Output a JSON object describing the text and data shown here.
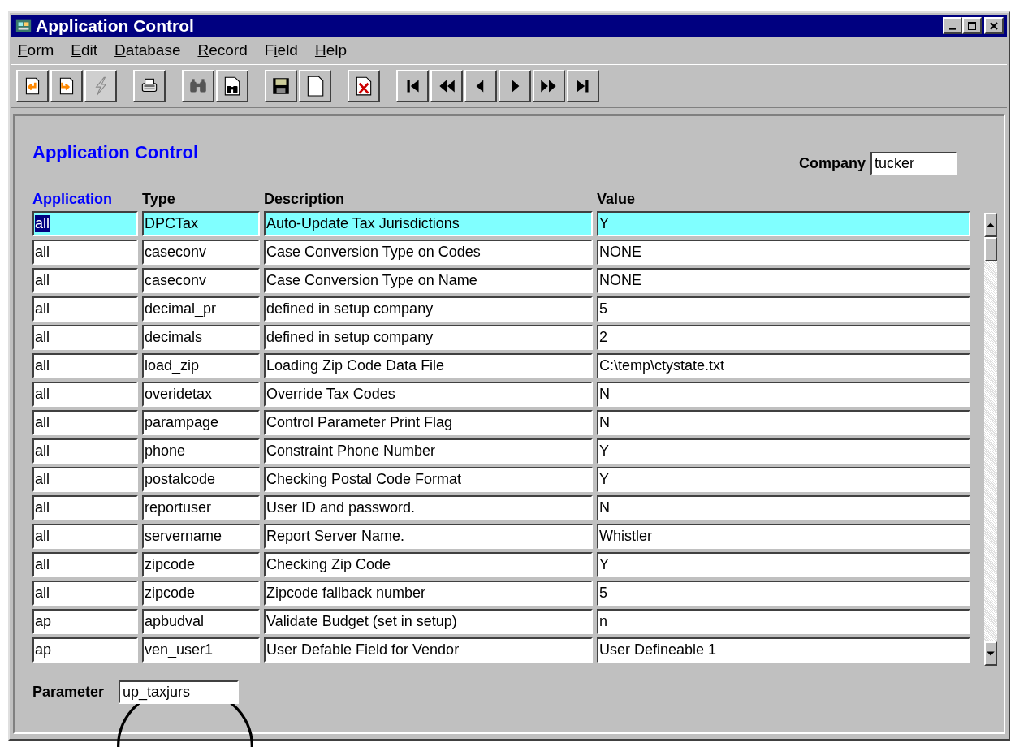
{
  "window": {
    "title": "Application Control"
  },
  "menu": [
    {
      "mnemonic": "F",
      "rest": "orm"
    },
    {
      "mnemonic": "E",
      "rest": "dit"
    },
    {
      "mnemonic": "D",
      "rest": "atabase"
    },
    {
      "mnemonic": "R",
      "rest": "ecord"
    },
    {
      "lead": "F",
      "mnemonic": "i",
      "rest": "eld"
    },
    {
      "mnemonic": "H",
      "rest": "elp"
    }
  ],
  "toolbar": [
    [
      {
        "kind": "enter",
        "disabled": false
      },
      {
        "kind": "exit",
        "disabled": false
      },
      {
        "kind": "execute",
        "disabled": true
      }
    ],
    [
      {
        "kind": "print",
        "disabled": false
      }
    ],
    [
      {
        "kind": "find",
        "disabled": false
      },
      {
        "kind": "findpage",
        "disabled": false
      }
    ],
    [
      {
        "kind": "save",
        "disabled": false
      },
      {
        "kind": "new",
        "disabled": false
      }
    ],
    [
      {
        "kind": "delete",
        "disabled": false
      }
    ],
    [
      {
        "kind": "first",
        "disabled": false
      },
      {
        "kind": "prevpage",
        "disabled": false
      },
      {
        "kind": "prev",
        "disabled": false
      },
      {
        "kind": "next",
        "disabled": false
      },
      {
        "kind": "nextpage",
        "disabled": false
      },
      {
        "kind": "last",
        "disabled": false
      }
    ]
  ],
  "form": {
    "heading": "Application Control",
    "company": {
      "label": "Company",
      "value": "tucker"
    },
    "table": {
      "columns": [
        {
          "label": "Application",
          "active": true
        },
        {
          "label": "Type",
          "active": false
        },
        {
          "label": "Description",
          "active": false
        },
        {
          "label": "Value",
          "active": false
        }
      ],
      "rows": [
        {
          "selected": true,
          "cells": [
            "all",
            "DPCTax",
            "Auto-Update Tax Jurisdictions",
            "Y"
          ]
        },
        {
          "selected": false,
          "cells": [
            "all",
            "caseconv",
            "Case Conversion Type on Codes",
            "NONE"
          ]
        },
        {
          "selected": false,
          "cells": [
            "all",
            "caseconv",
            "Case Conversion Type on Name",
            "NONE"
          ]
        },
        {
          "selected": false,
          "cells": [
            "all",
            "decimal_pr",
            "defined in setup company",
            "5"
          ]
        },
        {
          "selected": false,
          "cells": [
            "all",
            "decimals",
            "defined in setup company",
            "2"
          ]
        },
        {
          "selected": false,
          "cells": [
            "all",
            "load_zip",
            "Loading Zip Code Data File",
            "C:\\temp\\ctystate.txt"
          ]
        },
        {
          "selected": false,
          "cells": [
            "all",
            "overidetax",
            "Override Tax Codes",
            "N"
          ]
        },
        {
          "selected": false,
          "cells": [
            "all",
            "parampage",
            "Control Parameter Print Flag",
            "N"
          ]
        },
        {
          "selected": false,
          "cells": [
            "all",
            "phone",
            "Constraint Phone Number",
            "Y"
          ]
        },
        {
          "selected": false,
          "cells": [
            "all",
            "postalcode",
            "Checking Postal Code Format",
            "Y"
          ]
        },
        {
          "selected": false,
          "cells": [
            "all",
            "reportuser",
            "User ID and password.",
            "N"
          ]
        },
        {
          "selected": false,
          "cells": [
            "all",
            "servername",
            "Report Server Name.",
            "Whistler"
          ]
        },
        {
          "selected": false,
          "cells": [
            "all",
            "zipcode",
            "Checking Zip Code",
            "Y"
          ]
        },
        {
          "selected": false,
          "cells": [
            "all",
            "zipcode",
            "Zipcode fallback number",
            "5"
          ]
        },
        {
          "selected": false,
          "cells": [
            "ap",
            "apbudval",
            "Validate Budget (set in setup)",
            "n"
          ]
        },
        {
          "selected": false,
          "cells": [
            "ap",
            "ven_user1",
            "User Defable Field for Vendor",
            "User Defineable 1"
          ]
        }
      ]
    },
    "parameter": {
      "label": "Parameter",
      "value": "up_taxjurs"
    }
  }
}
